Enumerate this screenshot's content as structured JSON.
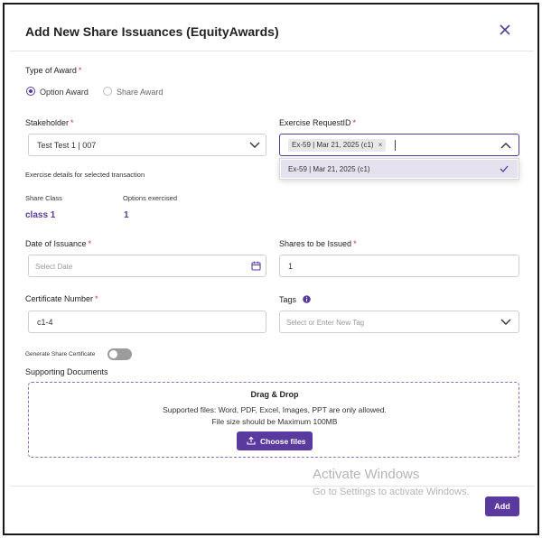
{
  "modal": {
    "title": "Add New Share Issuances (EquityAwards)"
  },
  "type_of_award": {
    "label": "Type of Award",
    "options": [
      {
        "label": "Option Award",
        "selected": true
      },
      {
        "label": "Share Award",
        "selected": false
      }
    ]
  },
  "stakeholder": {
    "label": "Stakeholder",
    "value": "Test Test 1 | 007"
  },
  "exercise_request": {
    "label": "Exercise RequestID",
    "chip": "Ex-59 | Mar 21, 2025 (c1)",
    "dropdown_option": "Ex-59 | Mar 21, 2025 (c1)"
  },
  "exercise_details": {
    "heading": "Exercise details for selected transaction",
    "share_class_label": "Share Class",
    "share_class_value": "class 1",
    "options_exercised_label": "Options exercised",
    "options_exercised_value": "1"
  },
  "date_of_issuance": {
    "label": "Date of Issuance",
    "placeholder": "Select Date"
  },
  "shares_to_be_issued": {
    "label": "Shares to be Issued",
    "value": "1"
  },
  "certificate_number": {
    "label": "Certificate Number",
    "value": "c1-4"
  },
  "tags": {
    "label": "Tags",
    "placeholder": "Select or Enter New Tag"
  },
  "generate_certificate": {
    "label": "Generate Share Certificate",
    "enabled": false
  },
  "supporting_documents": {
    "label": "Supporting Documents",
    "drag_drop": "Drag & Drop",
    "supported_files": "Supported files: Word, PDF, Excel, Images, PPT are only allowed.",
    "file_size": "File size should be Maximum 100MB",
    "choose_files": "Choose files"
  },
  "watermark": {
    "line1": "Activate Windows",
    "line2": "Go to Settings to activate Windows."
  },
  "footer": {
    "add_label": "Add"
  },
  "colors": {
    "accent": "#5b3aa0",
    "required": "#e0245e"
  }
}
